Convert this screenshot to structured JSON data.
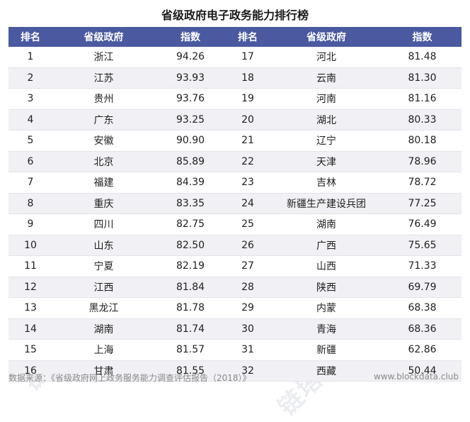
{
  "title": "省级政府电子政务能力排行榜",
  "headers": [
    "排名",
    "省级政府",
    "指数",
    "排名",
    "省级政府",
    "指数"
  ],
  "rows": [
    [
      "1",
      "浙江",
      "94.26",
      "17",
      "河北",
      "81.48"
    ],
    [
      "2",
      "江苏",
      "93.93",
      "18",
      "云南",
      "81.30"
    ],
    [
      "3",
      "贵州",
      "93.76",
      "19",
      "河南",
      "81.16"
    ],
    [
      "4",
      "广东",
      "93.25",
      "20",
      "湖北",
      "80.33"
    ],
    [
      "5",
      "安徽",
      "90.90",
      "21",
      "辽宁",
      "80.18"
    ],
    [
      "6",
      "北京",
      "85.89",
      "22",
      "天津",
      "78.96"
    ],
    [
      "7",
      "福建",
      "84.39",
      "23",
      "吉林",
      "78.72"
    ],
    [
      "8",
      "重庆",
      "83.35",
      "24",
      "新疆生产建设兵团",
      "77.25"
    ],
    [
      "9",
      "四川",
      "82.75",
      "25",
      "湖南",
      "76.49"
    ],
    [
      "10",
      "山东",
      "82.50",
      "26",
      "广西",
      "75.65"
    ],
    [
      "11",
      "宁夏",
      "82.19",
      "27",
      "山西",
      "71.33"
    ],
    [
      "12",
      "江西",
      "81.84",
      "28",
      "陕西",
      "69.79"
    ],
    [
      "13",
      "黑龙江",
      "81.78",
      "29",
      "内蒙",
      "68.38"
    ],
    [
      "14",
      "湖南",
      "81.74",
      "30",
      "青海",
      "68.36"
    ],
    [
      "15",
      "上海",
      "81.57",
      "31",
      "新疆",
      "62.86"
    ],
    [
      "16",
      "甘肃",
      "81.55",
      "32",
      "西藏",
      "50.44"
    ]
  ],
  "footer": {
    "source": "数据来源：《省级政府网上政务服务能力调查评估报告（2018）》",
    "site": "www.blockdata.club"
  },
  "watermark": {
    "brand": "链塔智库",
    "latin": "BlockData"
  },
  "colors": {
    "header_bg": "#4a59a0",
    "stripe": "#f0f0f5"
  }
}
